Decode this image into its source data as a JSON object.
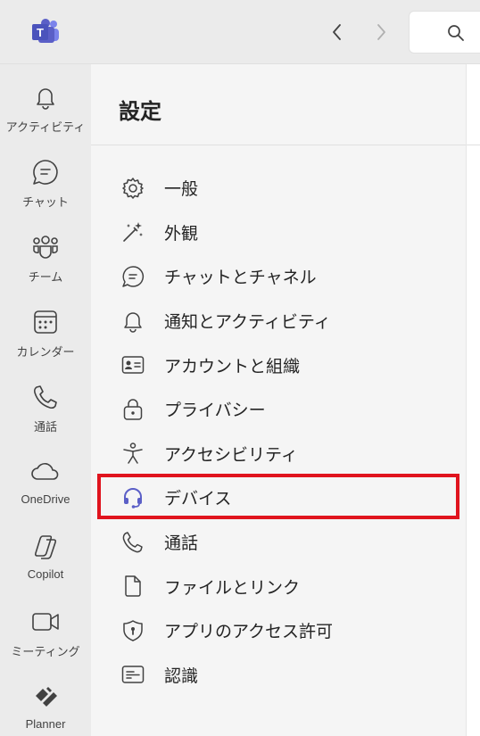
{
  "app": {
    "logo_icon": "teams-logo-icon",
    "brand_color": "#5b5fc7"
  },
  "header": {
    "back_icon": "chevron-left-icon",
    "forward_icon": "chevron-right-icon",
    "search_icon": "search-icon"
  },
  "rail": {
    "items": [
      {
        "label": "アクティビティ",
        "icon": "bell-icon"
      },
      {
        "label": "チャット",
        "icon": "chat-icon"
      },
      {
        "label": "チーム",
        "icon": "teams-icon"
      },
      {
        "label": "カレンダー",
        "icon": "calendar-icon"
      },
      {
        "label": "通話",
        "icon": "phone-icon"
      },
      {
        "label": "OneDrive",
        "icon": "cloud-icon"
      },
      {
        "label": "Copilot",
        "icon": "copilot-icon"
      },
      {
        "label": "ミーティング",
        "icon": "video-icon"
      },
      {
        "label": "Planner",
        "icon": "planner-icon"
      }
    ]
  },
  "settings": {
    "title": "設定",
    "items": [
      {
        "label": "一般",
        "icon": "gear-icon"
      },
      {
        "label": "外観",
        "icon": "magic-wand-icon"
      },
      {
        "label": "チャットとチャネル",
        "icon": "chat-icon"
      },
      {
        "label": "通知とアクティビティ",
        "icon": "bell-icon"
      },
      {
        "label": "アカウントと組織",
        "icon": "id-card-icon"
      },
      {
        "label": "プライバシー",
        "icon": "lock-icon"
      },
      {
        "label": "アクセシビリティ",
        "icon": "accessibility-icon"
      },
      {
        "label": "デバイス",
        "icon": "headset-icon",
        "selected": true
      },
      {
        "label": "通話",
        "icon": "phone-icon"
      },
      {
        "label": "ファイルとリンク",
        "icon": "file-icon"
      },
      {
        "label": "アプリのアクセス許可",
        "icon": "shield-key-icon"
      },
      {
        "label": "認識",
        "icon": "caption-icon"
      }
    ],
    "highlight_color": "#e0141e"
  }
}
